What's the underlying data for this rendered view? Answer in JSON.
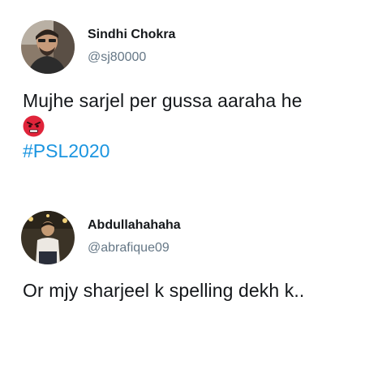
{
  "tweets": [
    {
      "display_name": "Sindhi Chokra",
      "handle": "@sj80000",
      "text": "Mujhe sarjel per gussa aaraha he",
      "emoji": "angry-face",
      "hashtag": "#PSL2020"
    },
    {
      "display_name": "Abdullahahaha",
      "handle": "@abrafique09",
      "text": "Or mjy sharjeel k spelling dekh k.."
    }
  ],
  "colors": {
    "text": "#14171a",
    "handle": "#657786",
    "hashtag": "#1b95e0",
    "emoji_red": "#e0243a"
  }
}
